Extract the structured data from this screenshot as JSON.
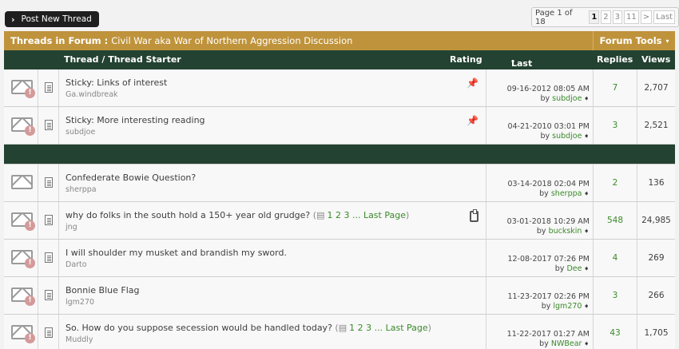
{
  "toolbar": {
    "post_label": "Post New Thread"
  },
  "pager": {
    "label": "Page 1 of 18",
    "pages": [
      "1",
      "2",
      "3",
      "11",
      ">",
      "Last"
    ],
    "arrow": "▾"
  },
  "forum": {
    "prefix": "Threads in Forum",
    "sep": " : ",
    "name": "Civil War aka War of Northern Aggression Discussion",
    "tools_label": "Forum Tools"
  },
  "header": {
    "thread": "Thread / Thread Starter",
    "rating": "Rating",
    "last_post": "Last Post",
    "replies": "Replies",
    "views": "Views"
  },
  "sticky_threads": [
    {
      "title": "Sticky: Links of interest",
      "starter": "Ga.windbreak",
      "date": "09-16-2012 08:05 AM",
      "by": "by",
      "user": "subdjoe",
      "replies": "7",
      "views": "2,707",
      "alert": "!"
    },
    {
      "title": "Sticky: More interesting reading",
      "starter": "subdjoe",
      "date": "04-21-2010 03:01 PM",
      "by": "by",
      "user": "subdjoe",
      "replies": "3",
      "views": "2,521",
      "alert": "!"
    }
  ],
  "threads": [
    {
      "title": "Confederate Bowie Question?",
      "starter": "sherppa",
      "date": "03-14-2018 02:04 PM",
      "by": "by",
      "user": "sherppa",
      "replies": "2",
      "views": "136"
    },
    {
      "title": "why do folks in the south hold a 150+ year old grudge?",
      "open": " (",
      "pages": "1 2 3 ... Last Page",
      "close": ")",
      "starter": "jng",
      "date": "03-01-2018 10:29 AM",
      "by": "by",
      "user": "buckskin",
      "replies": "548",
      "views": "24,985",
      "alert": "!"
    },
    {
      "title": "I will shoulder my musket and brandish my sword.",
      "starter": "Darto",
      "date": "12-08-2017 07:26 PM",
      "by": "by",
      "user": "Dee",
      "replies": "4",
      "views": "269",
      "alert": "!"
    },
    {
      "title": "Bonnie Blue Flag",
      "starter": "lgm270",
      "date": "11-23-2017 02:26 PM",
      "by": "by",
      "user": "lgm270",
      "replies": "3",
      "views": "266",
      "alert": "!"
    },
    {
      "title": "So. How do you suppose secession would be handled today?",
      "open": " (",
      "pages": "1 2 3 ... Last Page",
      "close": ")",
      "starter": "Muddly",
      "date": "11-22-2017 01:27 AM",
      "by": "by",
      "user": "NWBear",
      "replies": "43",
      "views": "1,705",
      "alert": "!"
    }
  ]
}
